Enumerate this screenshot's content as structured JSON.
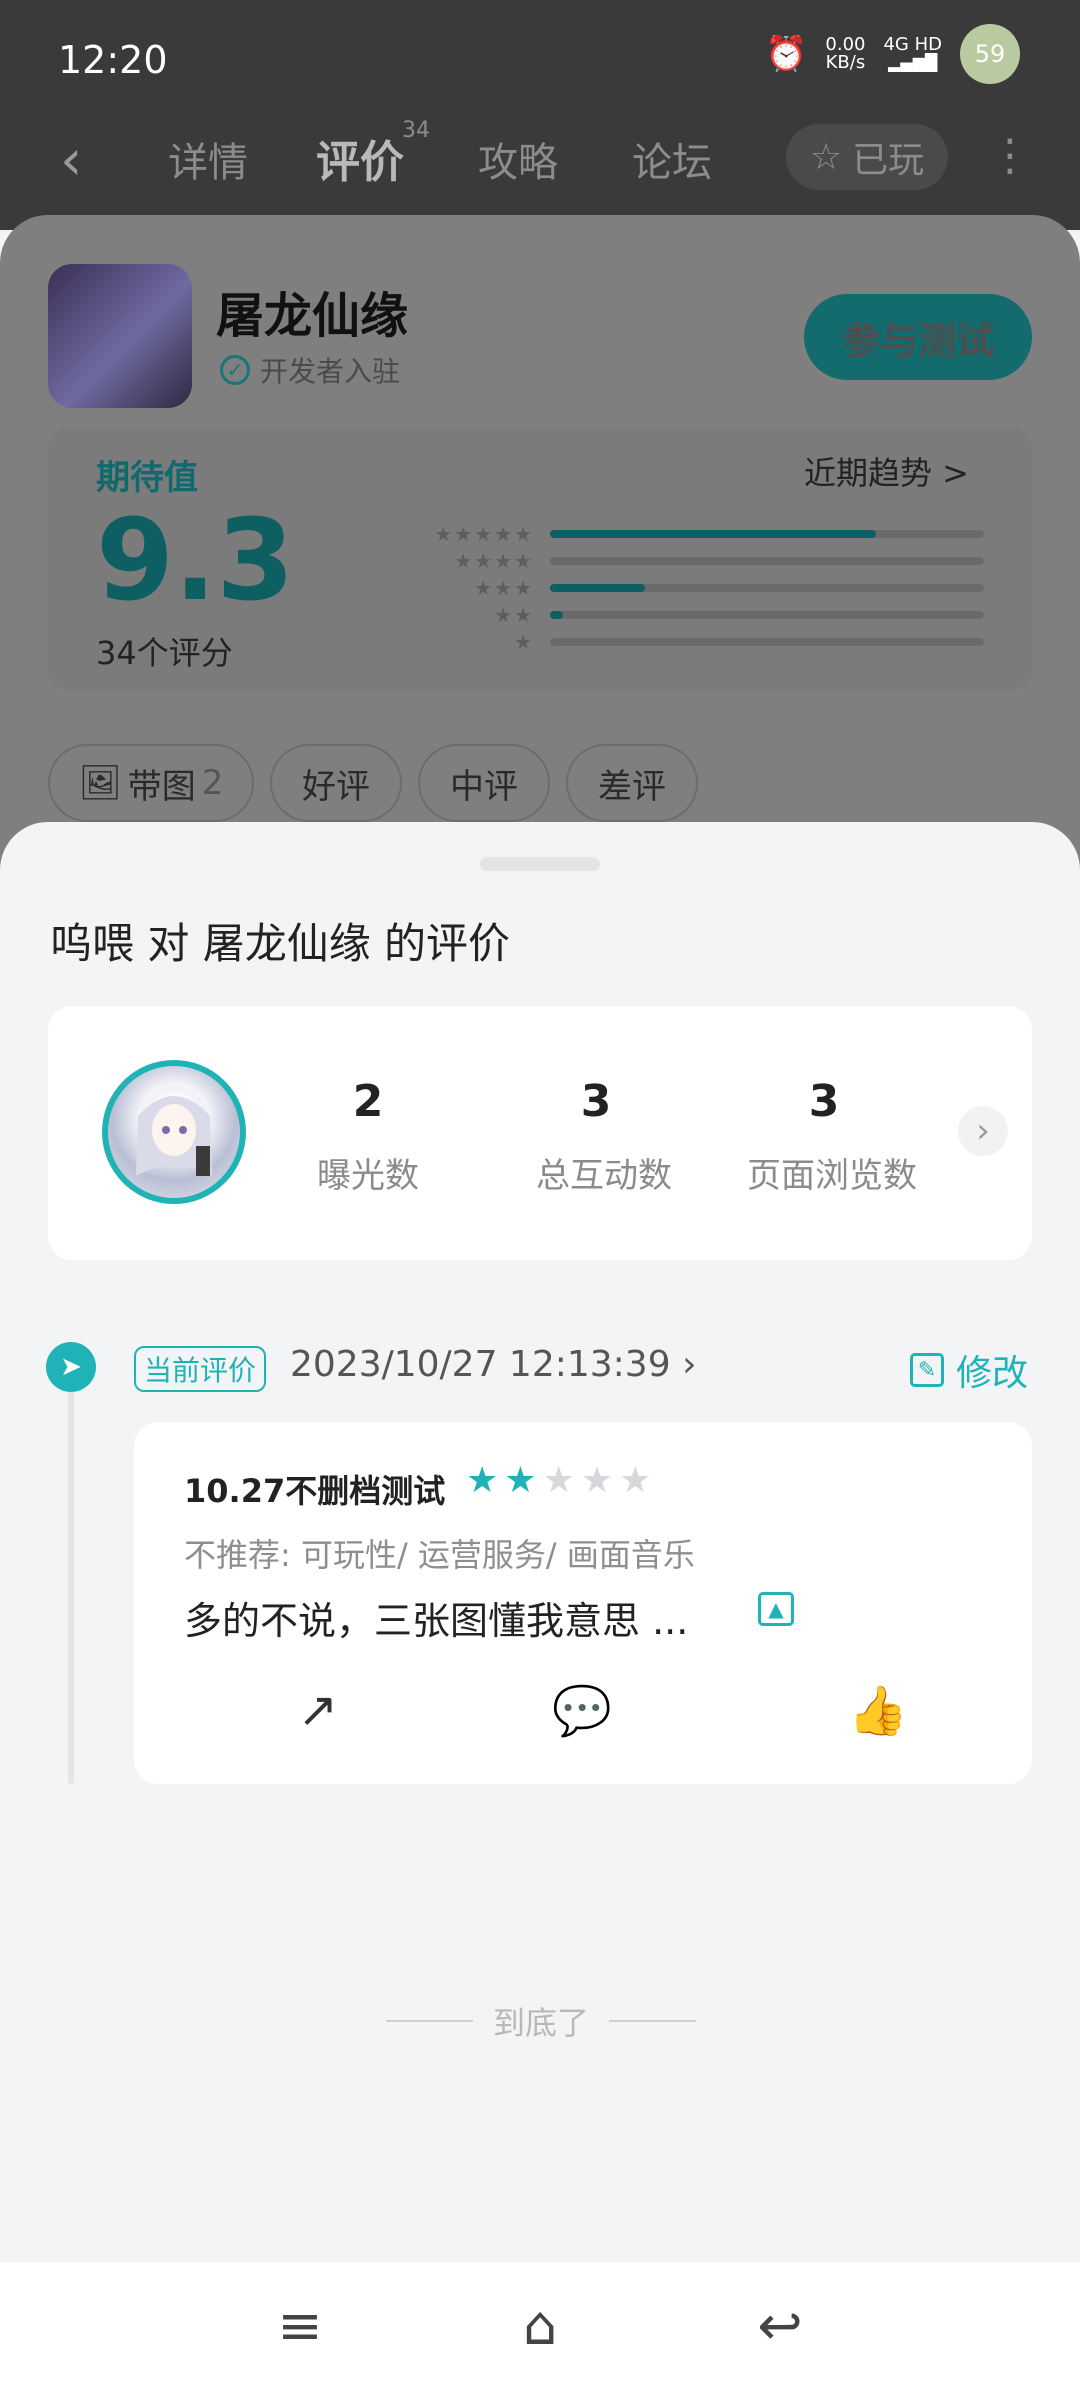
{
  "status_bar": {
    "time": "12:20",
    "net_speed_value": "0.00",
    "net_speed_unit": "KB/s",
    "network": "4G HD",
    "battery": "59"
  },
  "nav": {
    "back_icon": "back-arrow-icon",
    "tabs": [
      {
        "label": "详情"
      },
      {
        "label": "评价",
        "count": "34"
      },
      {
        "label": "攻略"
      },
      {
        "label": "论坛"
      }
    ],
    "played_label": "已玩",
    "more_icon": "more-vertical-icon"
  },
  "app": {
    "name": "屠龙仙缘",
    "developer_label": "开发者入驻",
    "join_button": "参与测试"
  },
  "rating": {
    "expect_label": "期待值",
    "score": "9.3",
    "count_label": "34个评分",
    "trend_label": "近期趋势 >",
    "distribution": [
      {
        "stars": "★★★★★",
        "fraction": 0.75
      },
      {
        "stars": "★★★★",
        "fraction": 0.0
      },
      {
        "stars": "★★★",
        "fraction": 0.22
      },
      {
        "stars": "★★",
        "fraction": 0.03
      },
      {
        "stars": "★",
        "fraction": 0.0
      }
    ]
  },
  "filters": [
    {
      "label": "带图",
      "count": "2"
    },
    {
      "label": "好评"
    },
    {
      "label": "中评"
    },
    {
      "label": "差评"
    }
  ],
  "sheet": {
    "title": "呜喂 对 屠龙仙缘 的评价",
    "stats": [
      {
        "value": "2",
        "label": "曝光数"
      },
      {
        "value": "3",
        "label": "总互动数"
      },
      {
        "value": "3",
        "label": "页面浏览数"
      }
    ],
    "current_tag": "当前评价",
    "review_time": "2023/10/27 12:13:39 ›",
    "edit_label": "修改",
    "review": {
      "title": "10.27不删档测试",
      "rating": 2,
      "rating_max": 5,
      "tags": "不推荐: 可玩性/ 运营服务/ 画面音乐",
      "body": "多的不说，三张图懂我意思 ..."
    },
    "end_text": "到底了"
  },
  "colors": {
    "accent": "#1fb3b7",
    "dim_overlay": "#7f7f7f"
  }
}
